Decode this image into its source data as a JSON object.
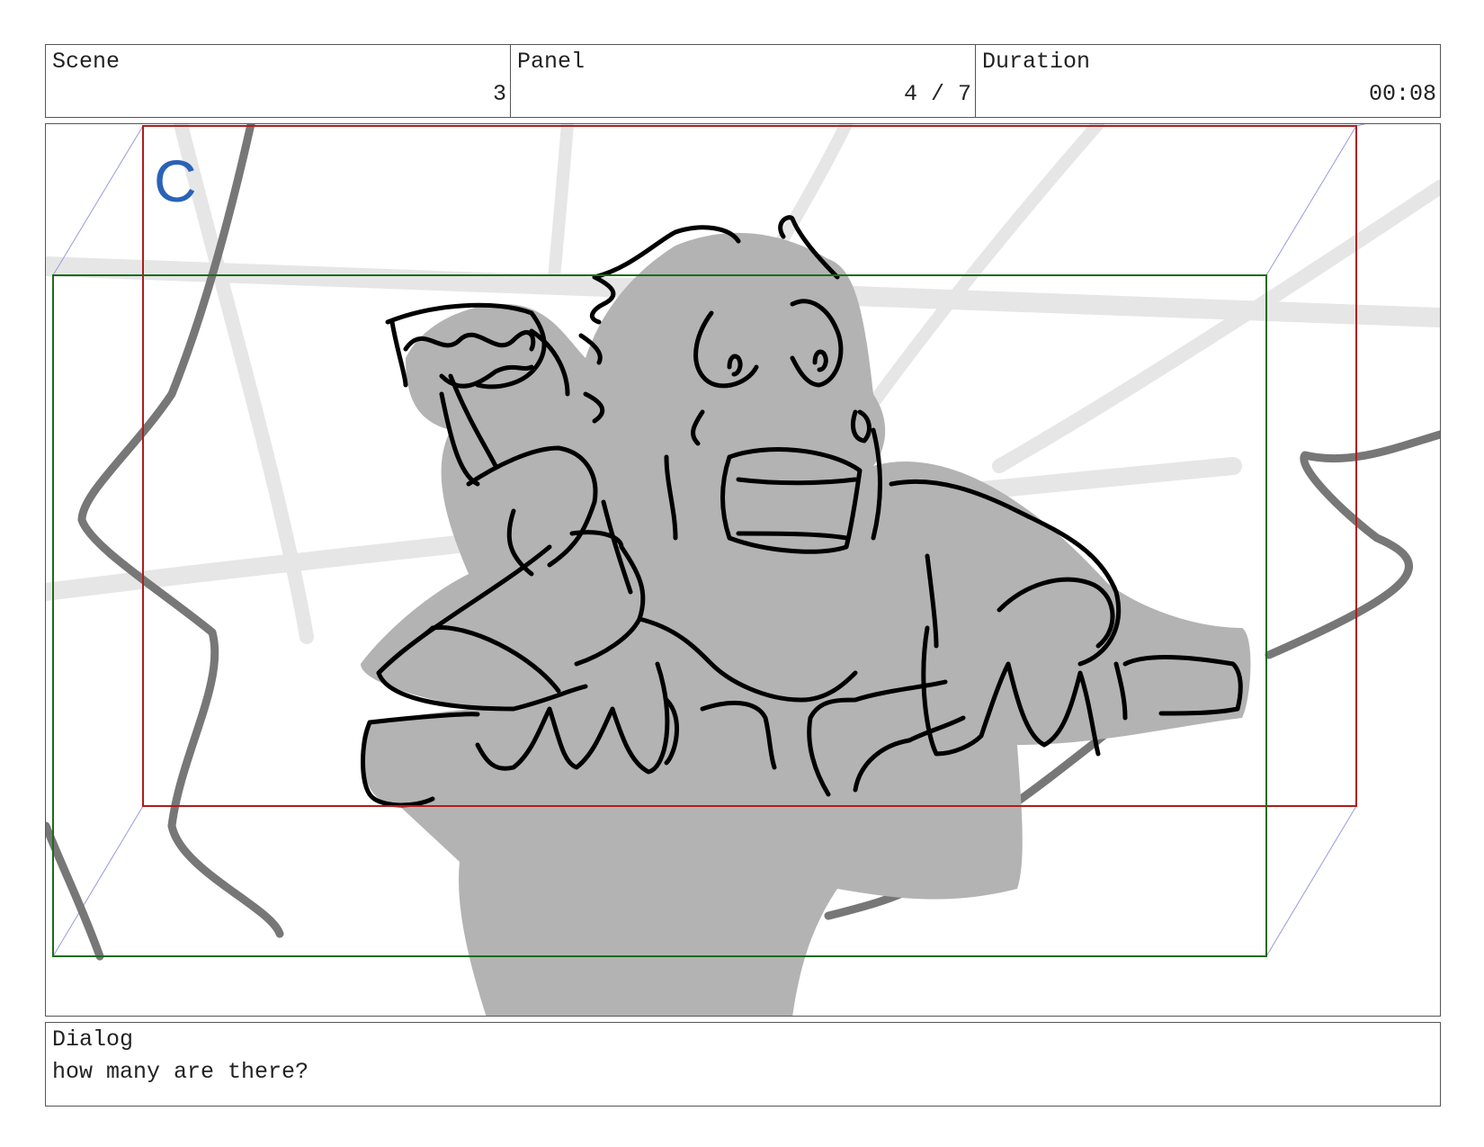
{
  "header": {
    "scene": {
      "label": "Scene",
      "value": "3"
    },
    "panel": {
      "label": "Panel",
      "value": "4 / 7"
    },
    "duration": {
      "label": "Duration",
      "value": "00:08"
    }
  },
  "artwork": {
    "camera_label": "C",
    "colors": {
      "camera_frame": "#b01c1c",
      "safe_frame": "#1d6b1d",
      "perspective_guides": "#9999dd",
      "background_lines": "#e6e6e6",
      "rocks": "#777777",
      "fill": "#b3b3b3",
      "ink": "#000000",
      "camera_label": "#2a62b8"
    }
  },
  "dialog": {
    "label": "Dialog",
    "text": "how many are there?"
  }
}
